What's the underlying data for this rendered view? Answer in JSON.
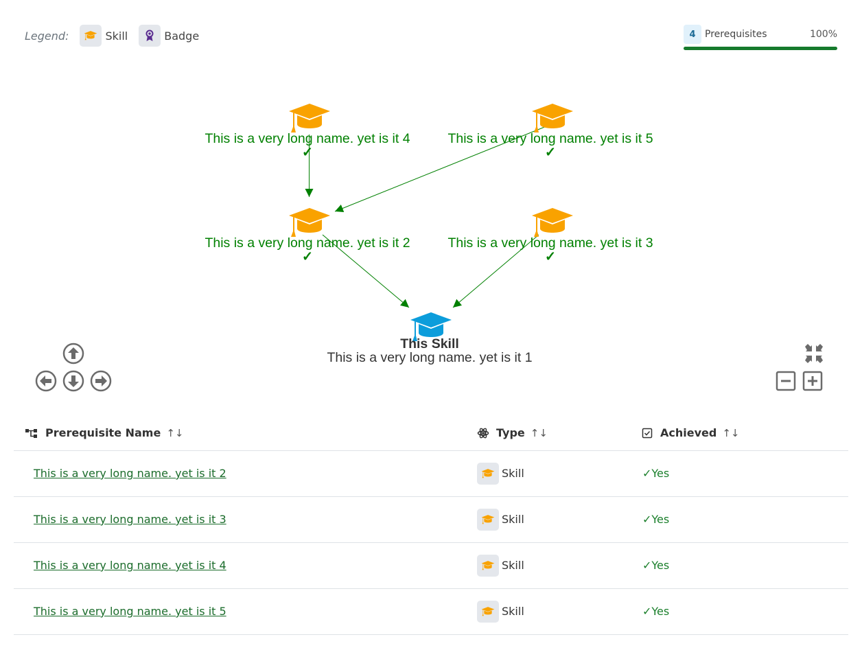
{
  "legend": {
    "label": "Legend:",
    "items": [
      {
        "label": "Skill",
        "icon": "graduation-cap-icon",
        "color": "#f9a200"
      },
      {
        "label": "Badge",
        "icon": "award-icon",
        "color": "#5b2d91"
      }
    ]
  },
  "progress": {
    "count": "4",
    "label": "Prerequisites",
    "percent_text": "100%",
    "fraction": 1.0,
    "color": "#157a2c"
  },
  "graph": {
    "prereq_color": "#008000",
    "skill_icon_color": "#f9a200",
    "this_skill_icon_color": "#0c9ddb",
    "center": {
      "title": "This Skill",
      "name": "This is a very long name. yet is it 1"
    },
    "nodes": [
      {
        "id": "n4",
        "name": "This is a very long name. yet is it 4",
        "check": "✓"
      },
      {
        "id": "n5",
        "name": "This is a very long name. yet is it 5",
        "check": "✓"
      },
      {
        "id": "n2",
        "name": "This is a very long name. yet is it 2",
        "check": "✓"
      },
      {
        "id": "n3",
        "name": "This is a very long name. yet is it 3",
        "check": "✓"
      }
    ],
    "edges": [
      {
        "from": "n4",
        "to": "n2"
      },
      {
        "from": "n5",
        "to": "n2"
      },
      {
        "from": "n2",
        "to": "n1"
      },
      {
        "from": "n3",
        "to": "n1"
      }
    ]
  },
  "table": {
    "columns": [
      {
        "label": "Prerequisite Name",
        "icon": "network-icon"
      },
      {
        "label": "Type",
        "icon": "atom-icon"
      },
      {
        "label": "Achieved",
        "icon": "checkbox-icon"
      }
    ],
    "sort_glyph": "↑↓",
    "rows": [
      {
        "name": "This is a very long name. yet is it 2",
        "type": "Skill",
        "achieved": "✓Yes"
      },
      {
        "name": "This is a very long name. yet is it 3",
        "type": "Skill",
        "achieved": "✓Yes"
      },
      {
        "name": "This is a very long name. yet is it 4",
        "type": "Skill",
        "achieved": "✓Yes"
      },
      {
        "name": "This is a very long name. yet is it 5",
        "type": "Skill",
        "achieved": "✓Yes"
      }
    ]
  }
}
